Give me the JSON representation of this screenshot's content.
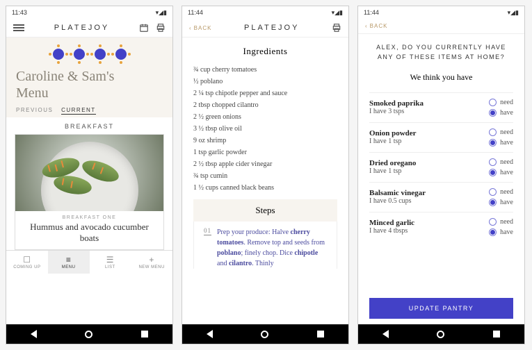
{
  "status": {
    "time1": "11:43",
    "time2": "11:44",
    "time3": "11:44",
    "icons": "▾◢▮"
  },
  "brand": "PLATEJOY",
  "back": "BACK",
  "screen1": {
    "menu_title_1": "Caroline & Sam's",
    "menu_title_2": "Menu",
    "tab_previous": "PREVIOUS",
    "tab_current": "CURRENT",
    "meal_section": "BREAKFAST",
    "meal_sub": "BREAKFAST ONE",
    "meal_name": "Hummus and avocado cucumber boats",
    "tabs": {
      "coming_up": "COMING UP",
      "menu": "MENU",
      "list": "LIST",
      "new_menu": "NEW MENU"
    }
  },
  "screen2": {
    "ingredients_title": "Ingredients",
    "ingredients": [
      "¾ cup cherry tomatoes",
      "½ poblano",
      "2 ¼ tsp chipotle pepper and sauce",
      "2 tbsp chopped cilantro",
      "2 ½ green onions",
      "3 ½ tbsp olive oil",
      "9 oz shrimp",
      "1 tsp garlic powder",
      "2 ½ tbsp apple cider vinegar",
      "¾ tsp cumin",
      "1 ½ cups canned black beans"
    ],
    "steps_title": "Steps",
    "step_num": "01",
    "step_pre": "Prep your produce: Halve ",
    "step_b1": "cherry tomatoes",
    "step_mid1": ". Remove top and seeds from ",
    "step_b2": "poblano",
    "step_mid2": "; finely chop. Dice ",
    "step_b3": "chipotle",
    "step_mid3": " and ",
    "step_b4": "cilantro",
    "step_end": ". Thinly"
  },
  "screen3": {
    "question_l1": "ALEX, DO YOU CURRENTLY HAVE",
    "question_l2": "ANY OF THESE ITEMS AT HOME?",
    "subtitle": "We think you have",
    "need": "need",
    "have": "have",
    "items": [
      {
        "name": "Smoked paprika",
        "qty": "I have 3 tsps"
      },
      {
        "name": "Onion powder",
        "qty": "I have 1 tsp"
      },
      {
        "name": "Dried oregano",
        "qty": "I have 1 tsp"
      },
      {
        "name": "Balsamic vinegar",
        "qty": "I have 0.5 cups"
      },
      {
        "name": "Minced garlic",
        "qty": "I have 4 tbsps"
      }
    ],
    "update": "UPDATE PANTRY"
  }
}
